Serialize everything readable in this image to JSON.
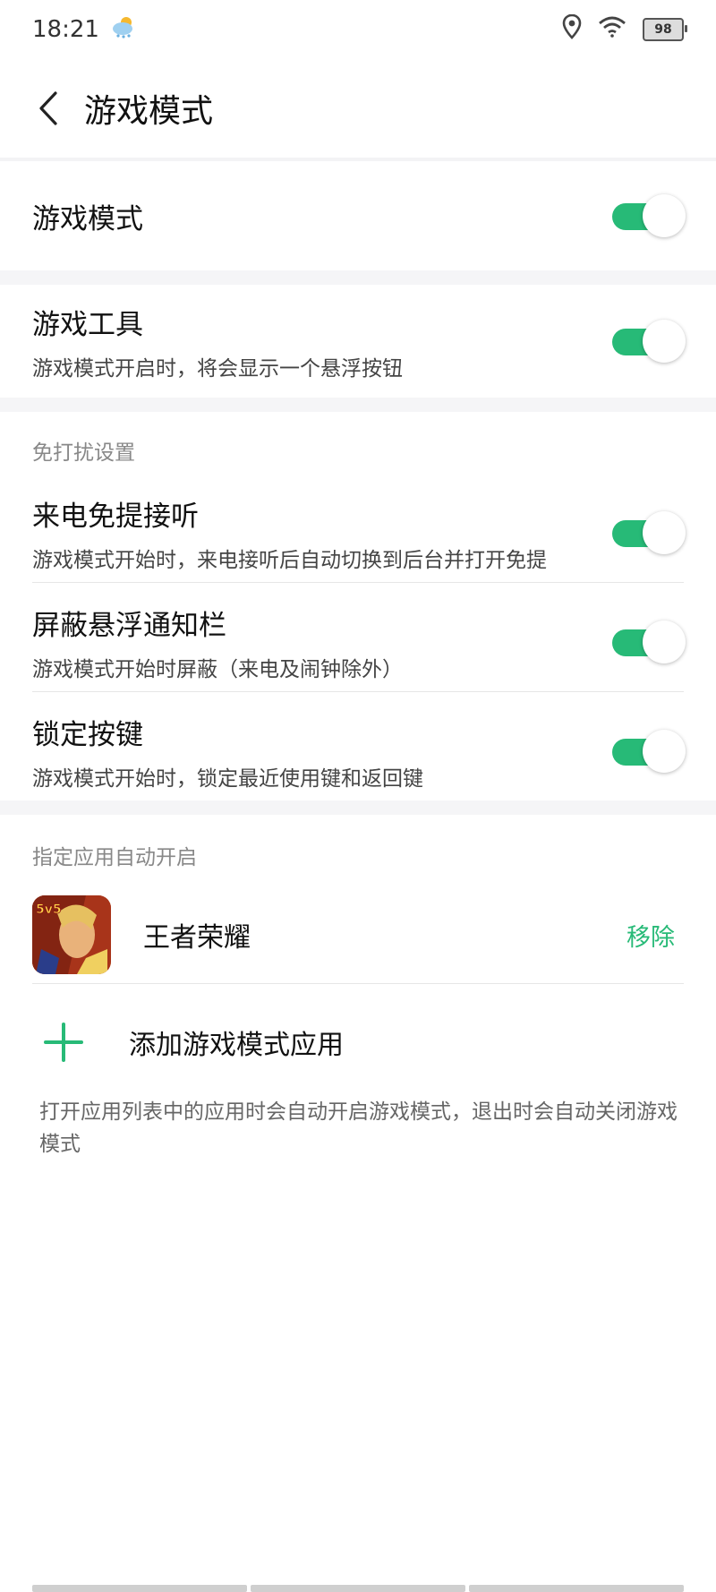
{
  "status_bar": {
    "time": "18:21",
    "weather_icon": "cloud-sun-icon",
    "battery": "98"
  },
  "header": {
    "title": "游戏模式"
  },
  "game_mode": {
    "title": "游戏模式",
    "enabled": true
  },
  "game_tools": {
    "title": "游戏工具",
    "subtitle": "游戏模式开启时，将会显示一个悬浮按钮",
    "enabled": true
  },
  "dnd": {
    "section_label": "免打扰设置",
    "items": [
      {
        "title": "来电免提接听",
        "subtitle": "游戏模式开始时，来电接听后自动切换到后台并打开免提",
        "enabled": true
      },
      {
        "title": "屏蔽悬浮通知栏",
        "subtitle": "游戏模式开始时屏蔽（来电及闹钟除外）",
        "enabled": true
      },
      {
        "title": "锁定按键",
        "subtitle": "游戏模式开始时，锁定最近使用键和返回键",
        "enabled": true
      }
    ]
  },
  "auto_apps": {
    "section_label": "指定应用自动开启",
    "apps": [
      {
        "name": "王者荣耀",
        "icon_badge": "5v5",
        "remove_label": "移除"
      }
    ],
    "add_label": "添加游戏模式应用",
    "note": "打开应用列表中的应用时会自动开启游戏模式，退出时会自动关闭游戏模式"
  },
  "colors": {
    "accent": "#27ba77",
    "divider_bg": "#f5f5f7"
  }
}
